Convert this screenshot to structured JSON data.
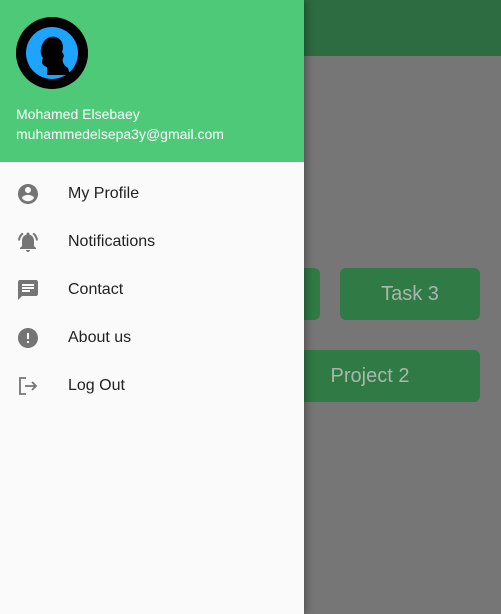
{
  "background": {
    "cards": [
      {
        "label": ""
      },
      {
        "label": "Task 3"
      },
      {
        "label": "Project 2"
      }
    ]
  },
  "drawer": {
    "header_color": "#4ec978",
    "user": {
      "name": "Mohamed Elsebaey",
      "email": "muhammedelsepa3y@gmail.com"
    },
    "items": [
      {
        "label": "My Profile",
        "icon": "account-circle-icon"
      },
      {
        "label": "Notifications",
        "icon": "notifications-active-icon"
      },
      {
        "label": "Contact",
        "icon": "chat-icon"
      },
      {
        "label": "About us",
        "icon": "info-exclamation-icon"
      },
      {
        "label": "Log Out",
        "icon": "logout-icon"
      }
    ]
  }
}
